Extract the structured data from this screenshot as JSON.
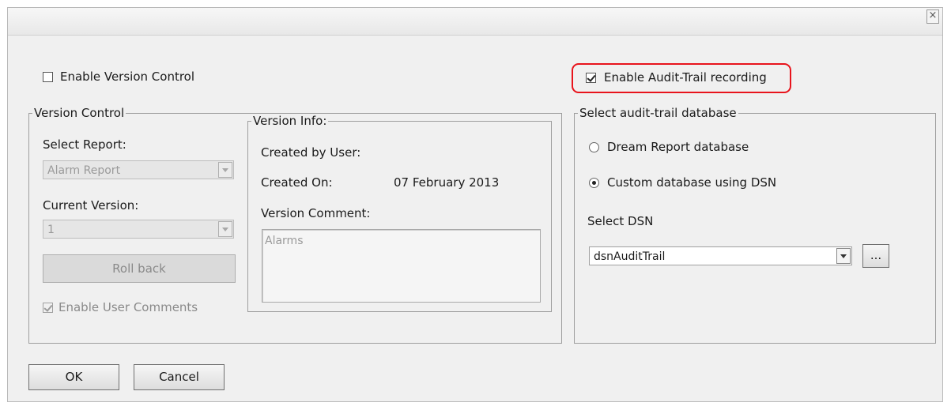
{
  "window": {
    "close_glyph": "×"
  },
  "enable_version_control": {
    "label": "Enable Version Control",
    "checked": false
  },
  "enable_audit_trail": {
    "label": "Enable Audit-Trail recording",
    "checked": true,
    "highlight_color": "#e8141c"
  },
  "version_control_group": {
    "legend": "Version Control",
    "select_report_label": "Select Report:",
    "select_report_value": "Alarm Report",
    "current_version_label": "Current Version:",
    "current_version_value": "1",
    "rollback_label": "Roll back",
    "enable_user_comments": {
      "label": "Enable User Comments",
      "checked": true
    }
  },
  "version_info_group": {
    "legend": "Version Info:",
    "created_by_label": "Created by User:",
    "created_by_value": "",
    "created_on_label": "Created On:",
    "created_on_value": "07 February 2013",
    "version_comment_label": "Version Comment:",
    "version_comment_value": "Alarms"
  },
  "audit_db_group": {
    "legend": "Select audit-trail database",
    "option_dream": {
      "label": "Dream Report database",
      "checked": false
    },
    "option_custom": {
      "label": "Custom database using DSN",
      "checked": true
    },
    "select_dsn_label": "Select DSN",
    "dsn_value": "dsnAuditTrail",
    "browse_label": "..."
  },
  "buttons": {
    "ok": "OK",
    "cancel": "Cancel"
  }
}
